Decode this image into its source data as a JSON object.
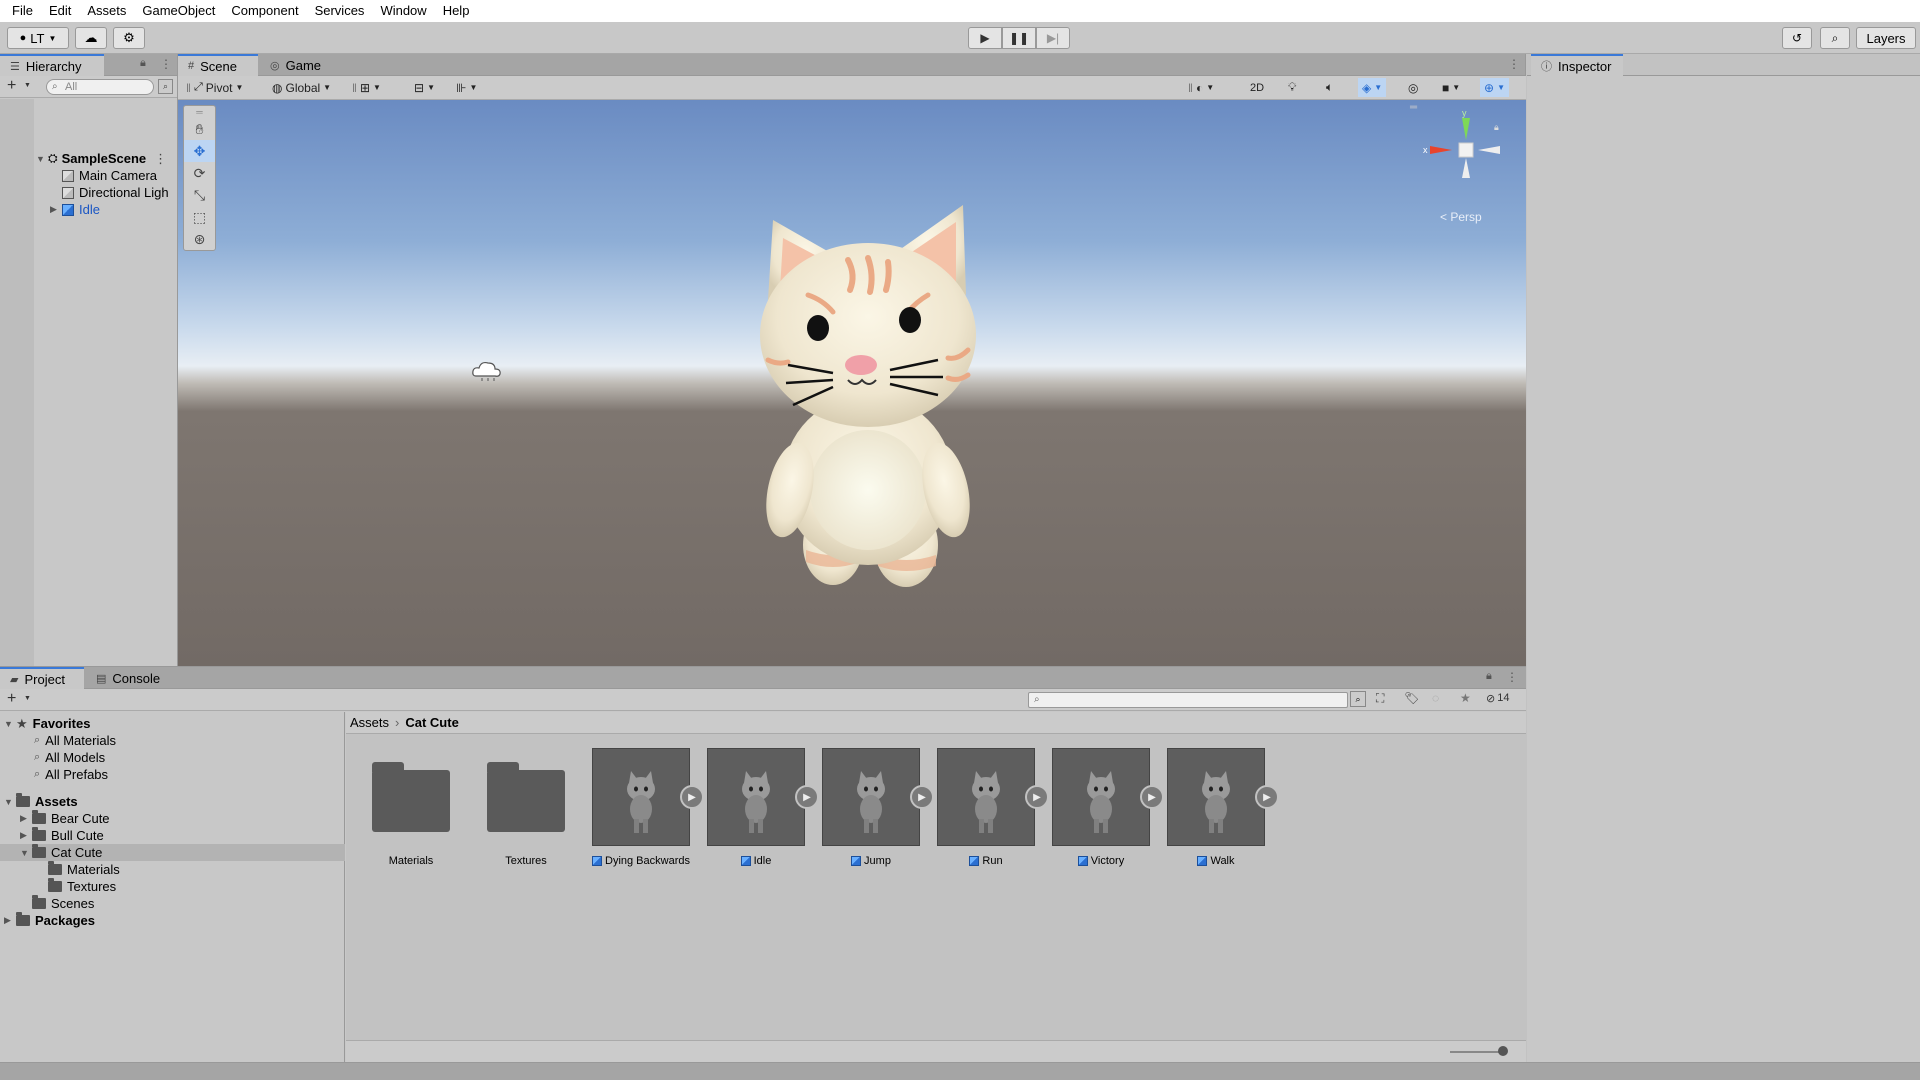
{
  "menu": [
    "File",
    "Edit",
    "Assets",
    "GameObject",
    "Component",
    "Services",
    "Window",
    "Help"
  ],
  "toolbar": {
    "account_label": "LT",
    "layers_label": "Layers"
  },
  "hierarchy": {
    "tab_label": "Hierarchy",
    "search_placeholder": "All",
    "scene_name": "SampleScene",
    "items": [
      "Main Camera",
      "Directional Ligh",
      "Idle"
    ]
  },
  "scene": {
    "tabs": [
      "Scene",
      "Game"
    ],
    "pivot_label": "Pivot",
    "global_label": "Global",
    "mode_2d_label": "2D",
    "persp_label": "< Persp",
    "gizmo_axis_x": "x",
    "gizmo_axis_y": "y"
  },
  "inspector": {
    "tab_label": "Inspector"
  },
  "project": {
    "tabs": [
      "Project",
      "Console"
    ],
    "favorites_label": "Favorites",
    "favorites": [
      "All Materials",
      "All Models",
      "All Prefabs"
    ],
    "assets_label": "Assets",
    "asset_folders": [
      "Bear Cute",
      "Bull Cute",
      "Cat Cute"
    ],
    "cat_children": [
      "Materials",
      "Textures"
    ],
    "scenes_label": "Scenes",
    "packages_label": "Packages",
    "breadcrumb": [
      "Assets",
      "Cat Cute"
    ],
    "hidden_count": "14",
    "grid_items": [
      {
        "name": "Materials",
        "kind": "folder"
      },
      {
        "name": "Textures",
        "kind": "folder"
      },
      {
        "name": "Dying Backwards",
        "kind": "anim"
      },
      {
        "name": "Idle",
        "kind": "anim"
      },
      {
        "name": "Jump",
        "kind": "anim"
      },
      {
        "name": "Run",
        "kind": "anim"
      },
      {
        "name": "Victory",
        "kind": "anim"
      },
      {
        "name": "Walk",
        "kind": "anim"
      }
    ]
  },
  "colors": {
    "accent": "#3a79d8",
    "selection_blue": "#2b6fd1",
    "panel_bg": "#c8c8c8"
  }
}
